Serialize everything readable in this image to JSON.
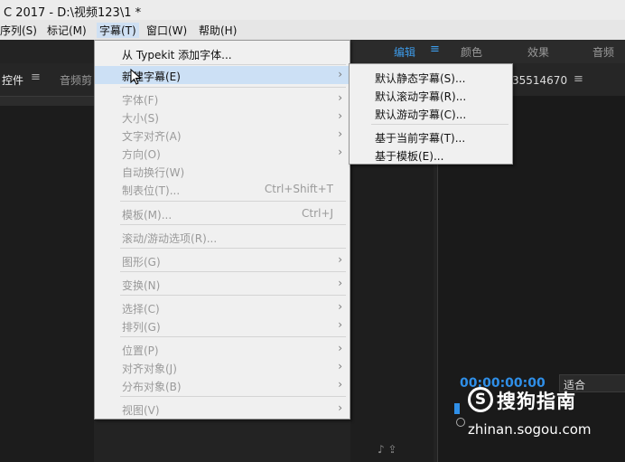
{
  "window": {
    "title": "C 2017 - D:\\视频123\\1 *"
  },
  "menubar": {
    "items": [
      "序列(S)",
      "标记(M)",
      "字幕(T)",
      "窗口(W)",
      "帮助(H)"
    ]
  },
  "workspaces": {
    "items": [
      "编辑",
      "颜色",
      "效果",
      "音频"
    ]
  },
  "left_panel": {
    "tab_controls": "控件",
    "tab_audio": "音频剪"
  },
  "right_panel": {
    "sequence_number": "35514670",
    "timecode": "00:00:00:00",
    "fit": "适合"
  },
  "caption_menu": {
    "items": [
      {
        "label": "从 Typekit 添加字体..."
      },
      {
        "label": "新建字幕(E)"
      },
      {
        "label": "字体(F)"
      },
      {
        "label": "大小(S)"
      },
      {
        "label": "文字对齐(A)"
      },
      {
        "label": "方向(O)"
      },
      {
        "label": "自动换行(W)"
      },
      {
        "label": "制表位(T)...",
        "shortcut": "Ctrl+Shift+T"
      },
      {
        "label": "模板(M)...",
        "shortcut": "Ctrl+J"
      },
      {
        "label": "滚动/游动选项(R)..."
      },
      {
        "label": "图形(G)"
      },
      {
        "label": "变换(N)"
      },
      {
        "label": "选择(C)"
      },
      {
        "label": "排列(G)"
      },
      {
        "label": "位置(P)"
      },
      {
        "label": "对齐对象(J)"
      },
      {
        "label": "分布对象(B)"
      },
      {
        "label": "视图(V)"
      }
    ]
  },
  "new_caption_submenu": {
    "items": [
      {
        "label": "默认静态字幕(S)..."
      },
      {
        "label": "默认滚动字幕(R)..."
      },
      {
        "label": "默认游动字幕(C)..."
      },
      {
        "label": "基于当前字幕(T)..."
      },
      {
        "label": "基于模板(E)..."
      }
    ]
  },
  "watermark": {
    "title": "搜狗指南",
    "url": "zhinan.sogou.com"
  },
  "colors": {
    "accent": "#3d9be9",
    "menu_bg": "#f0f0f0",
    "highlight": "#cce0f5",
    "app_bg": "#232323"
  }
}
